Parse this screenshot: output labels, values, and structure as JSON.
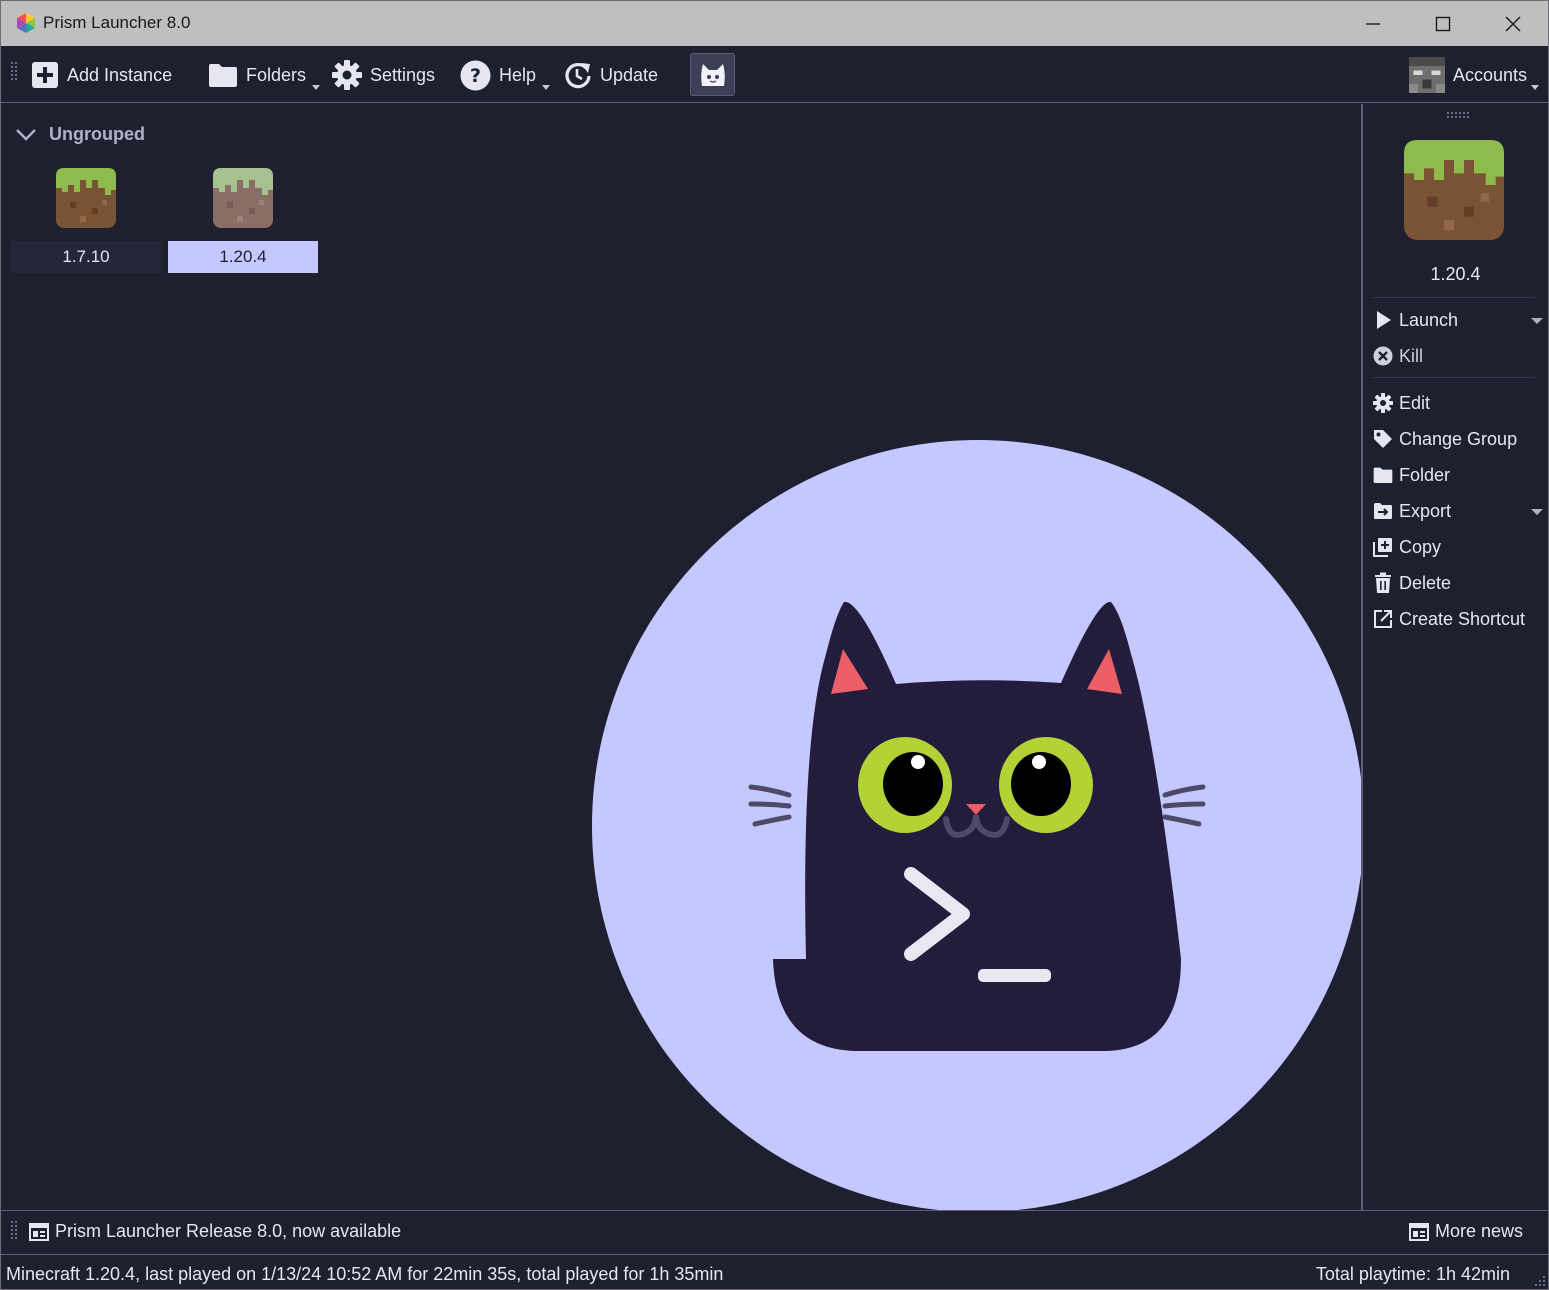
{
  "window": {
    "title": "Prism Launcher 8.0",
    "controls": [
      "minimize",
      "maximize",
      "close"
    ]
  },
  "toolbar": {
    "add_instance": "Add Instance",
    "folders": "Folders",
    "settings": "Settings",
    "help": "Help",
    "update": "Update",
    "cat_icon": "cat-icon",
    "accounts": "Accounts"
  },
  "instances": {
    "group": "Ungrouped",
    "items": [
      {
        "name": "1.7.10",
        "icon": "grass-block-icon",
        "selected": false
      },
      {
        "name": "1.20.4",
        "icon": "grass-block-icon",
        "selected": true
      }
    ]
  },
  "panel": {
    "instance_name": "1.20.4",
    "actions": {
      "launch": "Launch",
      "kill": "Kill",
      "edit": "Edit",
      "change_group": "Change Group",
      "folder": "Folder",
      "export": "Export",
      "copy": "Copy",
      "delete": "Delete",
      "create_shortcut": "Create Shortcut"
    }
  },
  "news": {
    "headline": "Prism Launcher Release 8.0, now available",
    "more": "More news"
  },
  "status": {
    "instance_info": "Minecraft 1.20.4, last played on 1/13/24 10:52 AM for 22min 35s, total played for 1h 35min",
    "total_playtime": "Total playtime: 1h 42min"
  },
  "colors": {
    "background": "#1e2030",
    "accent": "#c5c8ff",
    "cat_body": "#231c3c",
    "cat_eye": "#b2d235",
    "cat_ear": "#ec5f67"
  }
}
